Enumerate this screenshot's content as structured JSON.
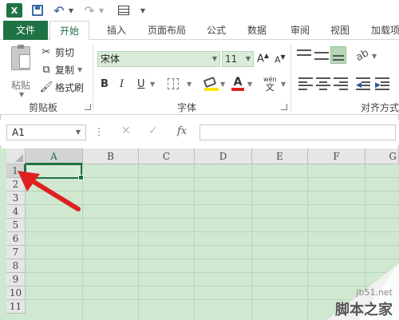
{
  "qat": {
    "excel_logo": "X",
    "undo_icon": "undo-icon",
    "redo_icon": "redo-icon"
  },
  "tabs": [
    {
      "label": "文件"
    },
    {
      "label": "开始"
    },
    {
      "label": "插入"
    },
    {
      "label": "页面布局"
    },
    {
      "label": "公式"
    },
    {
      "label": "数据"
    },
    {
      "label": "审阅"
    },
    {
      "label": "视图"
    },
    {
      "label": "加载项"
    }
  ],
  "clipboard": {
    "paste_label": "粘贴",
    "cut_label": "剪切",
    "copy_label": "复制",
    "painter_label": "格式刷",
    "group_label": "剪贴板"
  },
  "font": {
    "name": "宋体",
    "size": "11",
    "grow": "A",
    "shrink": "A",
    "bold": "B",
    "italic": "I",
    "underline": "U",
    "color_letter": "A",
    "wen_pinyin": "wén",
    "wen_char": "文",
    "group_label": "字体"
  },
  "alignment": {
    "group_label": "对齐方式"
  },
  "formula_bar": {
    "name_box": "A1",
    "fx": "fx",
    "cancel": "✕",
    "enter": "✓",
    "value": ""
  },
  "grid": {
    "columns": [
      "A",
      "B",
      "C",
      "D",
      "E",
      "F",
      "G"
    ],
    "rows": [
      "1",
      "2",
      "3",
      "4",
      "5",
      "6",
      "7",
      "8",
      "9",
      "10",
      "11"
    ],
    "active_cell": "A1"
  },
  "watermark": {
    "site": "jb51.net",
    "brand": "脚本之家"
  },
  "colors": {
    "excel_green": "#1f7244",
    "grid_bg": "#cfe8cf",
    "arrow": "#e02020"
  }
}
